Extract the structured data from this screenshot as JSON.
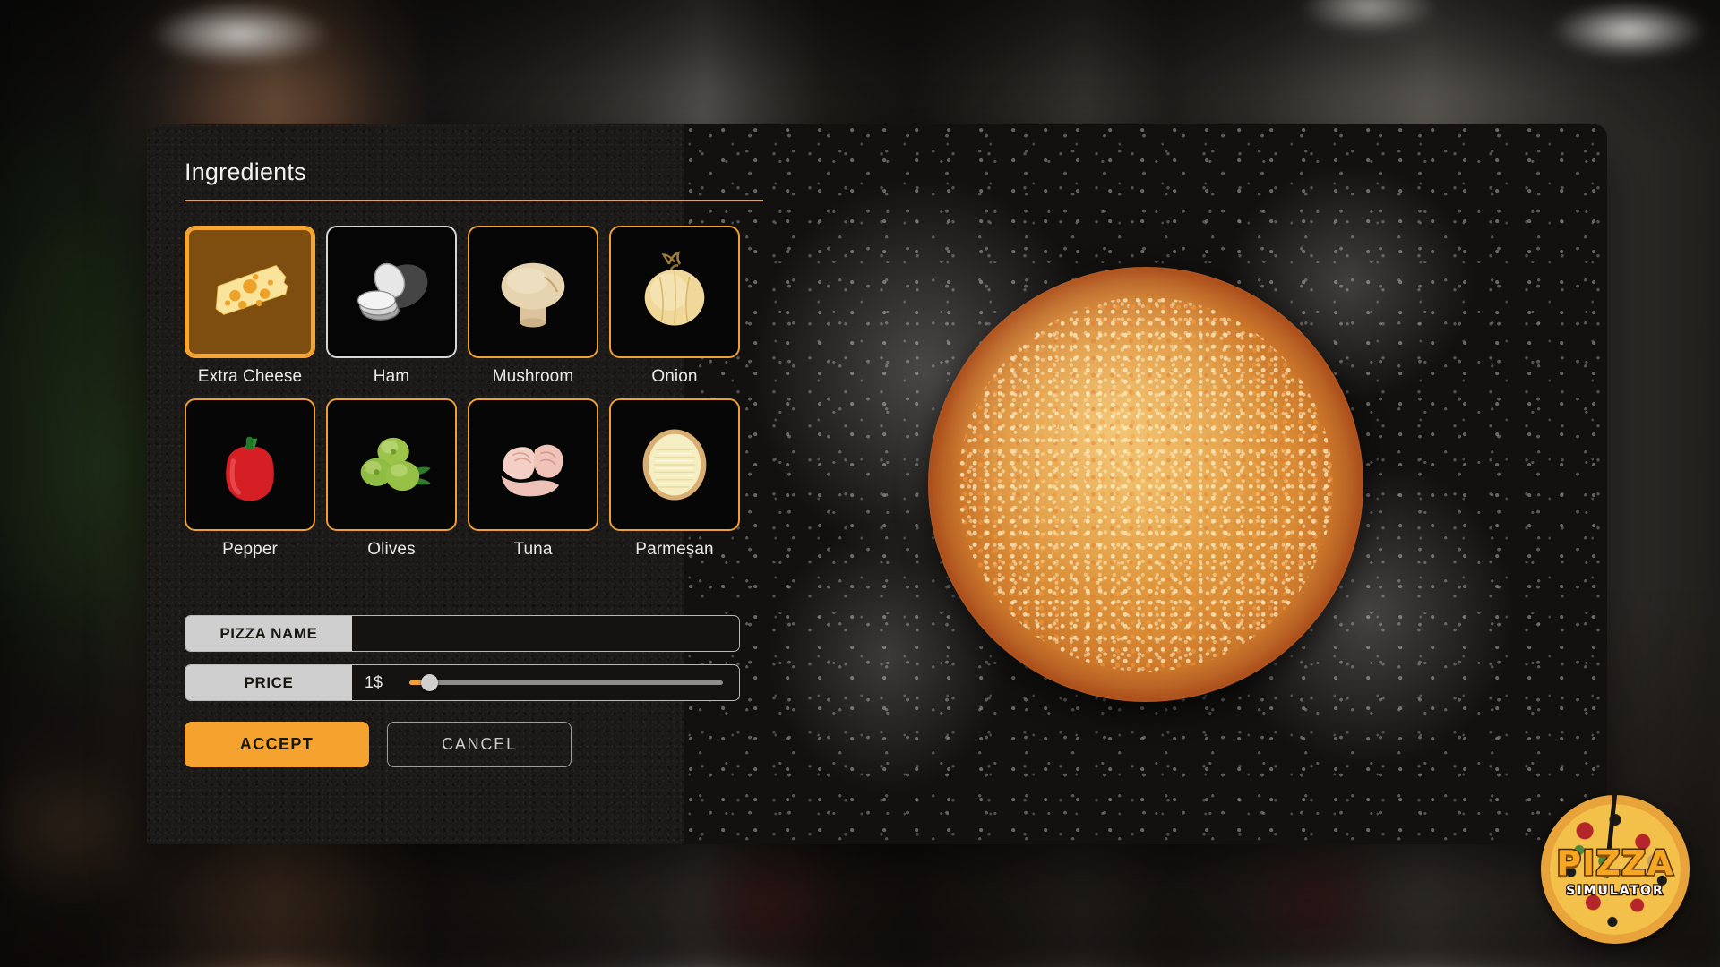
{
  "background": {
    "scene_description": "blurred pizzeria interior"
  },
  "dialog": {
    "title": "Ingredients"
  },
  "ingredients": [
    {
      "label": "Extra Cheese",
      "icon": "cheese-wedge-icon",
      "state": "selected"
    },
    {
      "label": "Ham",
      "icon": "ham-slices-icon",
      "state": "hovered"
    },
    {
      "label": "Mushroom",
      "icon": "mushroom-icon",
      "state": "normal"
    },
    {
      "label": "Onion",
      "icon": "onion-icon",
      "state": "normal"
    },
    {
      "label": "Pepper",
      "icon": "bell-pepper-icon",
      "state": "normal"
    },
    {
      "label": "Olives",
      "icon": "green-olives-icon",
      "state": "normal"
    },
    {
      "label": "Tuna",
      "icon": "tuna-chunks-icon",
      "state": "normal"
    },
    {
      "label": "Parmesan",
      "icon": "grated-parmesan-icon",
      "state": "normal"
    }
  ],
  "form": {
    "name_field": {
      "label": "PIZZA NAME",
      "value": "",
      "placeholder": ""
    },
    "price_field": {
      "label": "PRICE",
      "value": "1$",
      "slider_percent": 6
    }
  },
  "actions": {
    "accept_label": "ACCEPT",
    "cancel_label": "CANCEL"
  },
  "preview": {
    "pizza_description": "cheese pizza on floured dark surface"
  },
  "logo": {
    "title": "PIZZA",
    "subtitle": "SIMULATOR"
  },
  "colors": {
    "accent_orange": "#f2a13a",
    "accept_orange": "#f5a22f",
    "card_border": "#ef9f33",
    "card_selected_fill": "#7d4e10",
    "hover_border": "#d6d6d6",
    "panel_bg": "#1b1a19",
    "tag_gray": "#cfcfcf",
    "text_light": "#eceae7"
  }
}
